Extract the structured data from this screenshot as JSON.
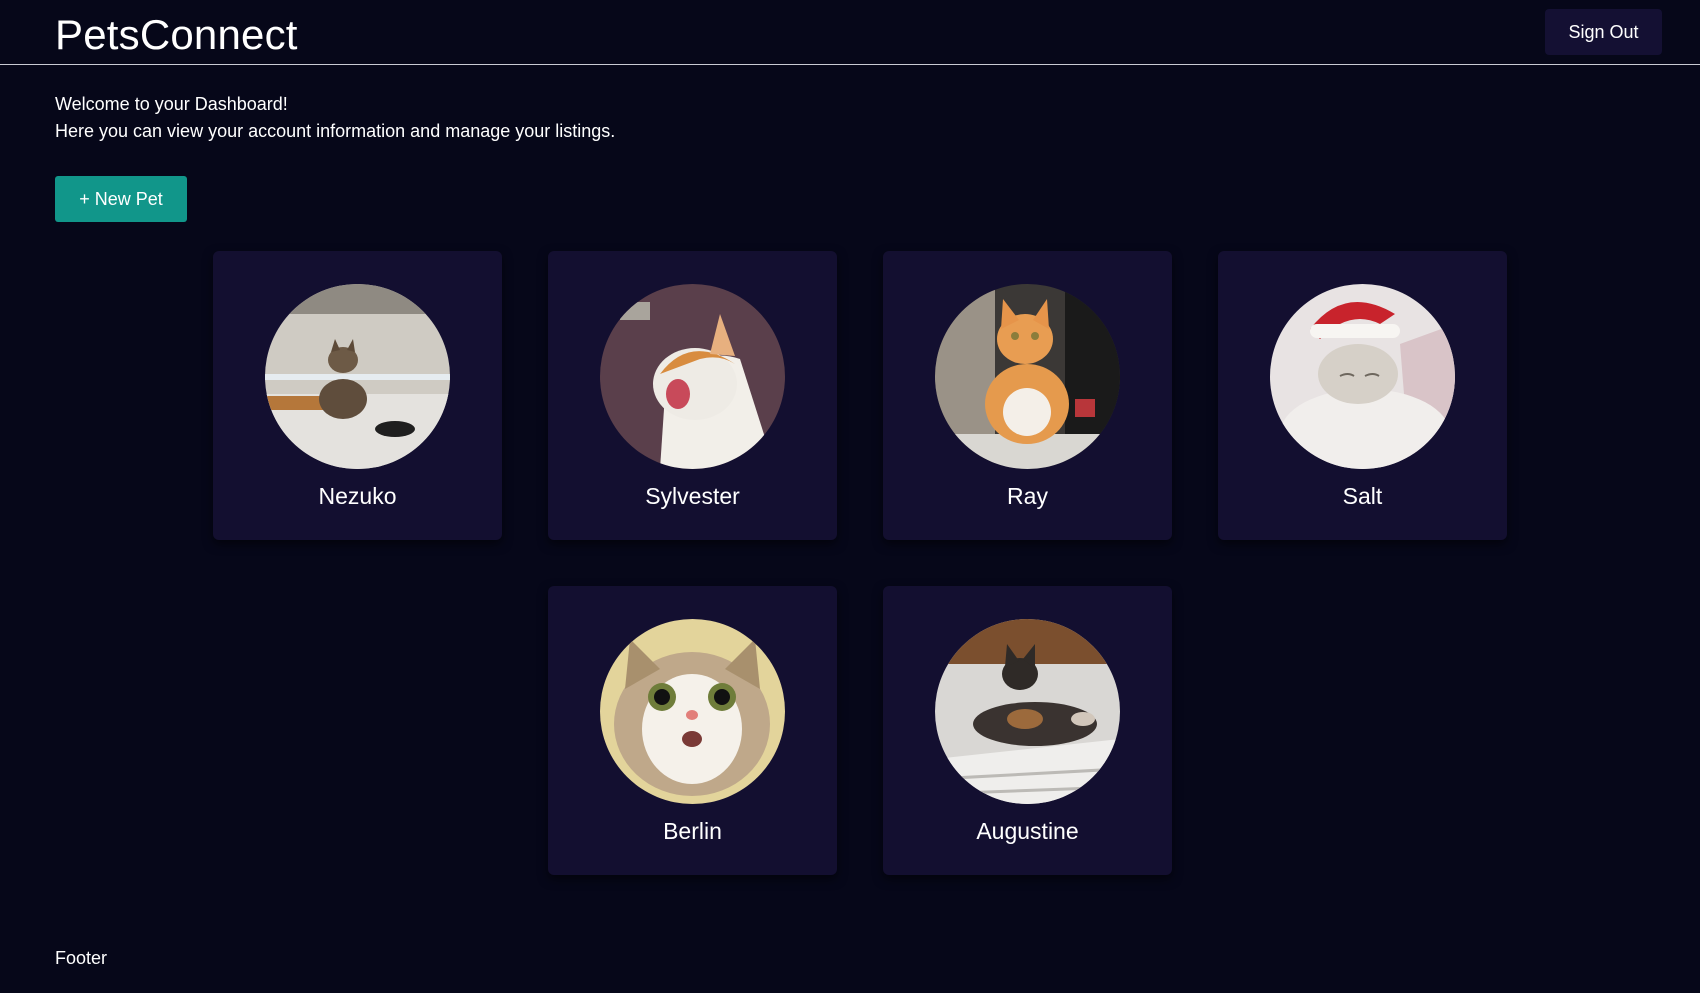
{
  "app": {
    "title": "PetsConnect"
  },
  "header": {
    "sign_out_label": "Sign Out"
  },
  "welcome": {
    "line1": "Welcome to your Dashboard!",
    "line2": "Here you can view your account information and manage your listings."
  },
  "actions": {
    "new_pet_label": "+ New Pet"
  },
  "pets": [
    {
      "name": "Nezuko"
    },
    {
      "name": "Sylvester"
    },
    {
      "name": "Ray"
    },
    {
      "name": "Salt"
    },
    {
      "name": "Berlin"
    },
    {
      "name": "Augustine"
    }
  ],
  "footer": {
    "text": "Footer"
  },
  "colors": {
    "background": "#060719",
    "card": "#130f30",
    "accent": "#11968a",
    "sign_out_bg": "#141033"
  }
}
